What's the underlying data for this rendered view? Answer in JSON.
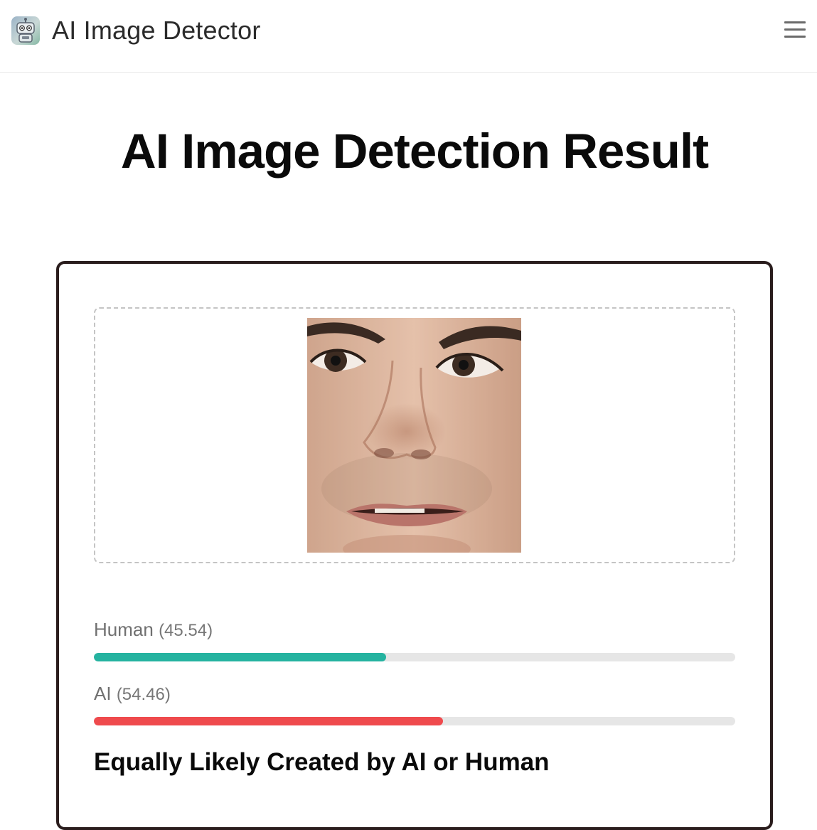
{
  "header": {
    "app_name": "AI Image Detector",
    "logo_icon": "robot-icon",
    "menu_icon": "hamburger-menu-icon"
  },
  "page": {
    "title": "AI Image Detection Result"
  },
  "result": {
    "uploaded_image": "face-photo",
    "human": {
      "label": "Human",
      "score": "(45.54)",
      "percent": 45.54,
      "color": "#25b3a0"
    },
    "ai": {
      "label": "AI",
      "score": "(54.46)",
      "percent": 54.46,
      "color": "#ef4a4d"
    },
    "verdict": "Equally Likely Created by AI or Human"
  }
}
